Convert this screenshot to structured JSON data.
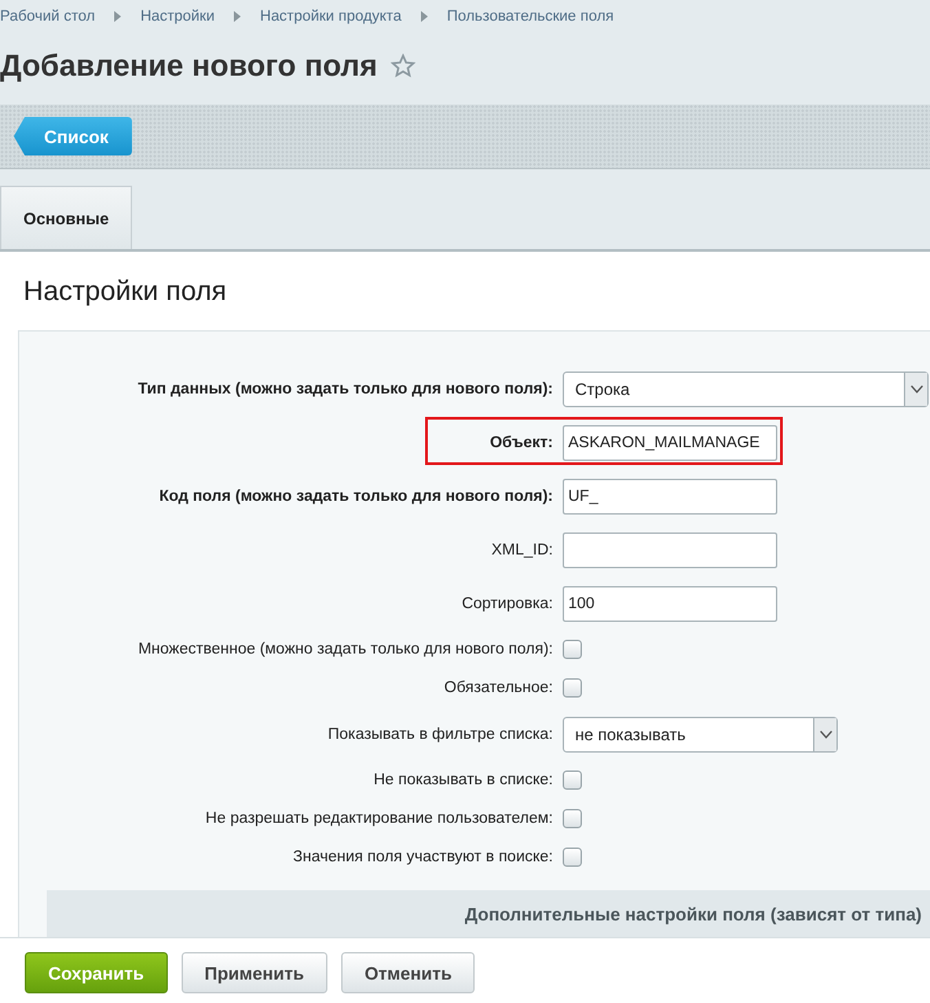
{
  "breadcrumbs": [
    "Рабочий стол",
    "Настройки",
    "Настройки продукта",
    "Пользовательские поля"
  ],
  "title": "Добавление нового поля",
  "toolbar": {
    "back_button": "Список"
  },
  "tabs": [
    {
      "label": "Основные",
      "selected": true
    }
  ],
  "section": {
    "title": "Настройки поля",
    "rows": [
      {
        "kind": "select",
        "label": "Тип данных (можно задать только для нового поля):",
        "bold": true,
        "value": "Строка",
        "wide": true,
        "highlighted": false
      },
      {
        "kind": "text",
        "label": "Объект:",
        "bold": true,
        "value": "ASKARON_MAILMANAGE",
        "highlighted": true
      },
      {
        "kind": "text",
        "label": "Код поля (можно задать только для нового поля):",
        "bold": true,
        "value": "UF_",
        "highlighted": false
      },
      {
        "kind": "text",
        "label": "XML_ID:",
        "bold": false,
        "highlighted": false
      },
      {
        "kind": "text",
        "label": "Сортировка:",
        "bold": false,
        "value": "100",
        "highlighted": false
      },
      {
        "kind": "checkbox",
        "label": "Множественное (можно задать только для нового поля):",
        "bold": false,
        "checked": false,
        "highlighted": false
      },
      {
        "kind": "checkbox",
        "label": "Обязательное:",
        "bold": false,
        "checked": false,
        "highlighted": false
      },
      {
        "kind": "select",
        "label": "Показывать в фильтре списка:",
        "bold": false,
        "value": "не показывать",
        "wide": false,
        "highlighted": false
      },
      {
        "kind": "checkbox",
        "label": "Не показывать в списке:",
        "bold": false,
        "checked": false,
        "highlighted": false
      },
      {
        "kind": "checkbox",
        "label": "Не разрешать редактирование пользователем:",
        "bold": false,
        "checked": false,
        "highlighted": false
      },
      {
        "kind": "checkbox",
        "label": "Значения поля участвуют в поиске:",
        "bold": false,
        "checked": false,
        "highlighted": false
      }
    ],
    "subheading": "Дополнительные настройки поля (зависят от типа)"
  },
  "buttons": [
    {
      "label": "Сохранить",
      "kind": "primary"
    },
    {
      "label": "Применить",
      "kind": "default"
    },
    {
      "label": "Отменить",
      "kind": "default"
    }
  ]
}
